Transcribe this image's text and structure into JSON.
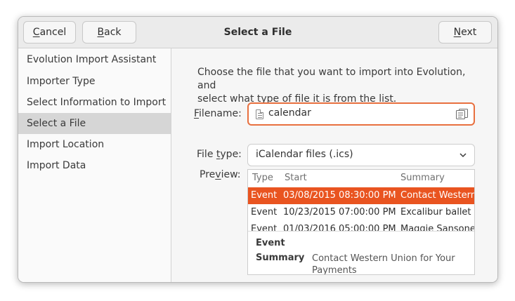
{
  "window": {
    "title": "Select a File"
  },
  "header": {
    "cancel_mnemonic": "C",
    "cancel_rest": "ancel",
    "back_mnemonic": "B",
    "back_rest": "ack",
    "next_mnemonic": "N",
    "next_rest": "ext"
  },
  "sidebar": {
    "items": [
      {
        "label": "Evolution Import Assistant"
      },
      {
        "label": "Importer Type"
      },
      {
        "label": "Select Information to Import"
      },
      {
        "label": "Select a File"
      },
      {
        "label": "Import Location"
      },
      {
        "label": "Import Data"
      }
    ],
    "selected": "Select a File"
  },
  "main": {
    "intro_line1": "Choose the file that you want to import into Evolution, and",
    "intro_line2": "select what type of file it is from the list.",
    "filename": {
      "label_mnemonic": "F",
      "label_rest": "ilename:",
      "value": "calendar",
      "file_icon": "text-file-icon",
      "browse_icon": "browse-files-icon"
    },
    "filetype": {
      "label_pre": "File ",
      "label_mnemonic": "t",
      "label_post": "ype:",
      "value": "iCalendar files (.ics)",
      "dropdown_icon": "chevron-down-icon"
    },
    "preview": {
      "label_pre": "Pre",
      "label_mnemonic": "v",
      "label_post": "iew:",
      "columns": [
        "Type",
        "Start",
        "Summary"
      ],
      "rows": [
        {
          "type": "Event",
          "start": "03/08/2015 08:30:00 PM",
          "summary": "Contact Western"
        },
        {
          "type": "Event",
          "start": "10/23/2015 07:00:00 PM",
          "summary": "Excalibur ballet"
        },
        {
          "type": "Event",
          "start": "01/03/2016 05:00:00 PM",
          "summary": "Maggie Sansone"
        }
      ],
      "selected_row": 0,
      "detail": {
        "type_label": "Event",
        "summary_label": "Summary",
        "summary_line1": "Contact Western Union for Your",
        "summary_line2": "Payments"
      }
    }
  },
  "colors": {
    "accent": "#e95420",
    "focus_border": "#e8703f",
    "sidebar_selected": "#d6d6d6"
  }
}
